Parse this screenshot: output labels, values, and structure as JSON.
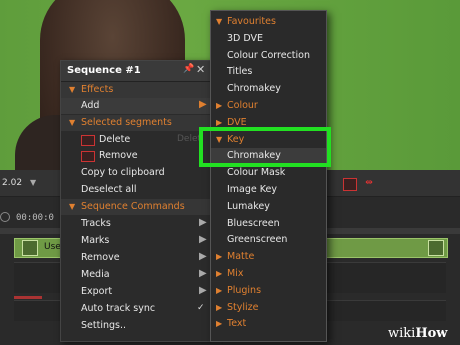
{
  "timeline": {
    "zoom": "2.02",
    "timecode": "00:00:0",
    "track_label": "Use"
  },
  "sequence_panel": {
    "title": "Sequence #1",
    "sections": {
      "effects": "Effects",
      "selected_segments": "Selected segments",
      "sequence_commands": "Sequence Commands"
    },
    "effects_items": [
      {
        "label": "Add"
      }
    ],
    "segment_items": [
      {
        "label": "Delete",
        "ghost": "Delet"
      },
      {
        "label": "Remove"
      },
      {
        "label": "Copy to clipboard"
      },
      {
        "label": "Deselect all"
      }
    ],
    "command_items": [
      {
        "label": "Tracks"
      },
      {
        "label": "Marks"
      },
      {
        "label": "Remove"
      },
      {
        "label": "Media"
      },
      {
        "label": "Export"
      },
      {
        "label": "Auto track sync"
      },
      {
        "label": "Settings.."
      }
    ]
  },
  "context_menu": {
    "items": [
      {
        "label": "Favourites",
        "kind": "header"
      },
      {
        "label": "3D DVE"
      },
      {
        "label": "Colour Correction"
      },
      {
        "label": "Titles"
      },
      {
        "label": "Chromakey"
      },
      {
        "label": "Colour",
        "kind": "submenu"
      },
      {
        "label": "DVE",
        "kind": "submenu"
      },
      {
        "label": "Key",
        "kind": "header"
      },
      {
        "label": "Chromakey",
        "hover": true
      },
      {
        "label": "Colour Mask"
      },
      {
        "label": "Image Key"
      },
      {
        "label": "Lumakey"
      },
      {
        "label": "Bluescreen"
      },
      {
        "label": "Greenscreen"
      },
      {
        "label": "Matte",
        "kind": "submenu"
      },
      {
        "label": "Mix",
        "kind": "submenu"
      },
      {
        "label": "Plugins",
        "kind": "submenu"
      },
      {
        "label": "Stylize",
        "kind": "submenu"
      },
      {
        "label": "Text",
        "kind": "submenu"
      }
    ]
  },
  "watermark": {
    "brand": "wiki",
    "suffix": "How"
  },
  "colors": {
    "accent": "#e08030",
    "highlight": "#22e022",
    "greenscreen": "#6aa842"
  }
}
